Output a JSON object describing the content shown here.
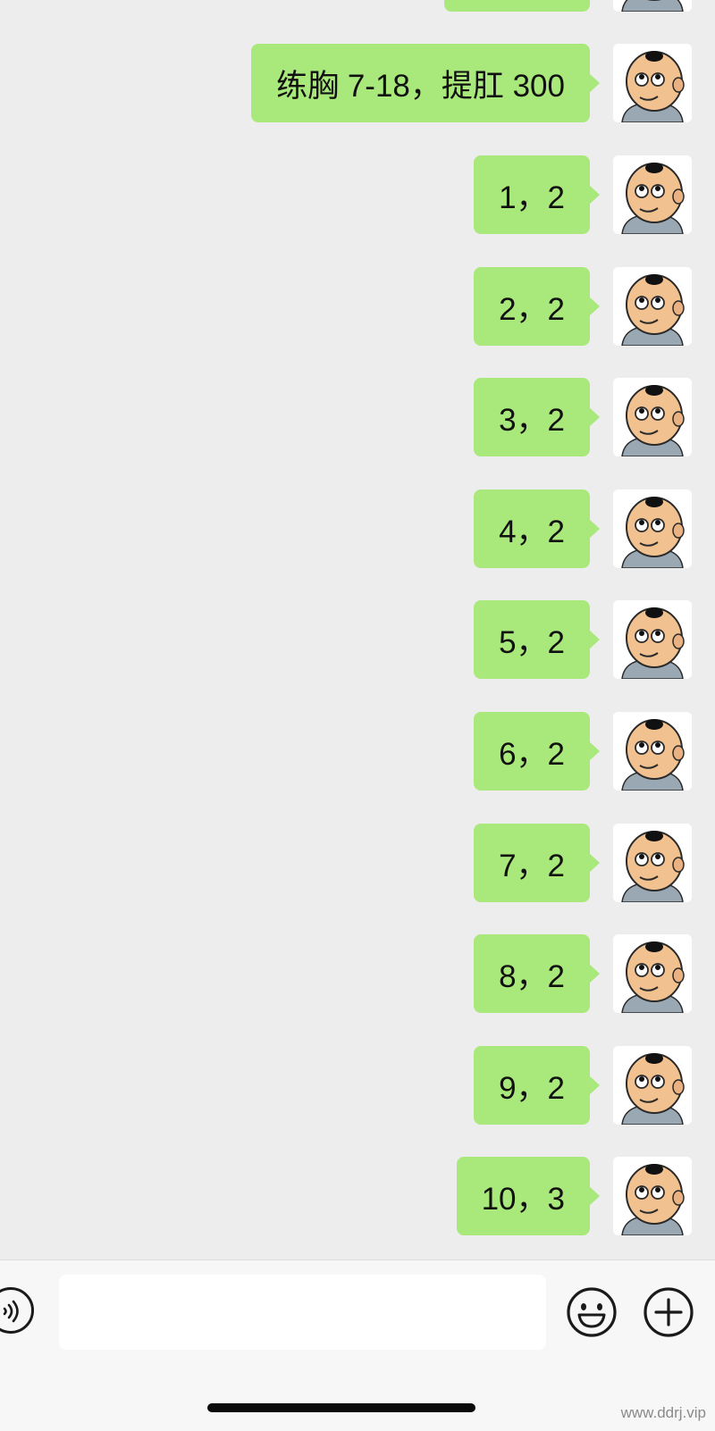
{
  "chat": {
    "messages": [
      {
        "text": "",
        "partial": true
      },
      {
        "text": "练胸 7-18，提肛 300"
      },
      {
        "text": "1，2"
      },
      {
        "text": "2，2"
      },
      {
        "text": "3，2"
      },
      {
        "text": "4，2"
      },
      {
        "text": "5，2"
      },
      {
        "text": "6，2"
      },
      {
        "text": "7，2"
      },
      {
        "text": "8，2"
      },
      {
        "text": "9，2"
      },
      {
        "text": "10，3"
      }
    ],
    "avatar_icon": "cartoon-baby-avatar-icon"
  },
  "input_bar": {
    "message_value": "",
    "voice_icon": "voice-icon",
    "emoji_icon": "emoji-icon",
    "plus_icon": "plus-icon"
  },
  "watermark": "www.ddrj.vip",
  "colors": {
    "background": "#ededed",
    "bubble_green": "#a9e87a",
    "input_bar": "#f7f7f7"
  }
}
